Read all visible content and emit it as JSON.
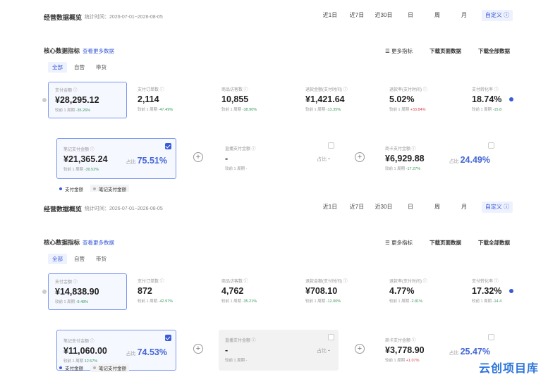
{
  "panels": [
    {
      "title": "经营数据概览",
      "range": "统计时间：2026-07-01~2026-08-05",
      "periods": [
        "近1日",
        "近7日",
        "近30日",
        "日",
        "周",
        "月"
      ],
      "custom_label": "自定义",
      "section_title": "核心数据指标",
      "section_link": "查看更多数据",
      "actions": [
        "更多指标",
        "下载页面数据",
        "下载全部数据"
      ],
      "tabs": [
        "全部",
        "自营",
        "带货"
      ],
      "metrics": [
        {
          "label": "支付金额",
          "value": "¥28,295.12",
          "change_prefix": "较前 1 周期",
          "change": "-35.26%"
        },
        {
          "label": "支付订单数",
          "value": "2,114",
          "change_prefix": "较前 1 周期",
          "change": "-47.49%"
        },
        {
          "label": "商品访客数",
          "value": "10,855",
          "change_prefix": "较前 1 周期",
          "change": "-38.90%"
        },
        {
          "label": "退款金额(支付时间)",
          "value": "¥1,421.64",
          "change_prefix": "较前 1 周期",
          "change": "-13.35%"
        },
        {
          "label": "退款率(支付时间)",
          "value": "5.02%",
          "change_prefix": "较前 1 周期",
          "change": "+33.84%"
        },
        {
          "label": "支付转化率",
          "value": "18.74%",
          "change_prefix": "较前 1 周期",
          "change": "-15.8"
        }
      ],
      "breakdown": [
        {
          "label": "笔记支付金额",
          "value": "¥21,365.24",
          "change_prefix": "较前 1 周期",
          "change": "-39.52%",
          "share_label": "占比",
          "share": "75.51%"
        },
        {
          "label": "直播支付金额",
          "value": "-",
          "change_prefix": "较前 1 周期",
          "change": "-",
          "share_label": "占比",
          "share": "-"
        },
        {
          "label": "商卡支付金额",
          "value": "¥6,929.88",
          "change_prefix": "较前 1 周期",
          "change": "-17.27%",
          "share_label": "占比",
          "share": "24.49%"
        }
      ],
      "legend": [
        "支付金额",
        "笔记支付金额"
      ]
    },
    {
      "title": "经营数据概览",
      "range": "统计时间：2026-07-01~2026-08-05",
      "periods": [
        "近1日",
        "近7日",
        "近30日",
        "日",
        "周",
        "月"
      ],
      "custom_label": "自定义",
      "section_title": "核心数据指标",
      "section_link": "查看更多数据",
      "actions": [
        "更多指标",
        "下载页面数据",
        "下载全部数据"
      ],
      "tabs": [
        "全部",
        "自营",
        "带货"
      ],
      "metrics": [
        {
          "label": "支付金额",
          "value": "¥14,838.90",
          "change_prefix": "较前 1 周期",
          "change": "-9.48%"
        },
        {
          "label": "支付订单数",
          "value": "872",
          "change_prefix": "较前 1 周期",
          "change": "-42.97%"
        },
        {
          "label": "商品访客数",
          "value": "4,762",
          "change_prefix": "较前 1 周期",
          "change": "-35.21%"
        },
        {
          "label": "退款金额(支付时间)",
          "value": "¥708.10",
          "change_prefix": "较前 1 周期",
          "change": "-12.00%"
        },
        {
          "label": "退款率(支付时间)",
          "value": "4.77%",
          "change_prefix": "较前 1 周期",
          "change": "-2.81%"
        },
        {
          "label": "支付转化率",
          "value": "17.32%",
          "change_prefix": "较前 1 周期",
          "change": "-14.4"
        }
      ],
      "breakdown": [
        {
          "label": "笔记支付金额",
          "value": "¥11,060.00",
          "change_prefix": "较前 1 周期",
          "change": "12.57%",
          "share_label": "占比",
          "share": "74.53%"
        },
        {
          "label": "直播支付金额",
          "value": "-",
          "change_prefix": "较前 1 周期",
          "change": "-",
          "share_label": "占比",
          "share": "-"
        },
        {
          "label": "商卡支付金额",
          "value": "¥3,778.90",
          "change_prefix": "较前 1 周期",
          "change": "+1.07%",
          "share_label": "占比",
          "share": "25.47%"
        }
      ],
      "legend": [
        "支付金额",
        "笔记支付金额"
      ]
    }
  ],
  "watermark": "云创项目库",
  "colors": {
    "accent": "#3a5bd9",
    "down": "#3c9a5f",
    "up": "#d9434f",
    "legend_1": "#3a5bd9",
    "legend_2": "#b0b6c3"
  }
}
